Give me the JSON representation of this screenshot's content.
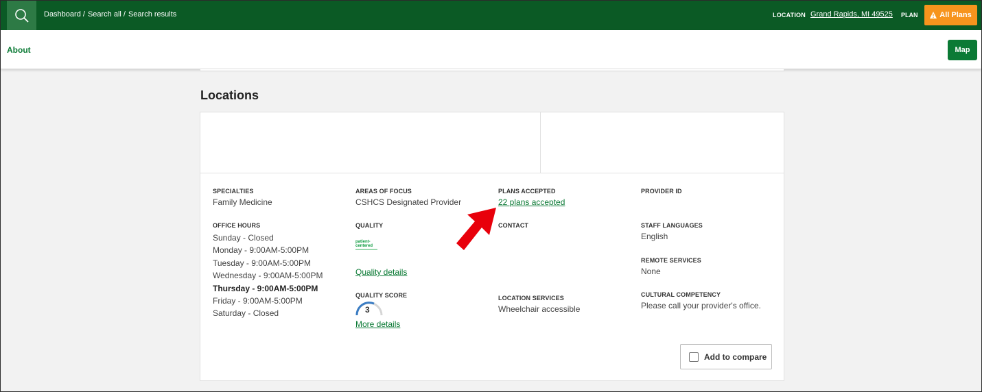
{
  "header": {
    "breadcrumbs": [
      "Dashboard /",
      "Search all /",
      "Search results"
    ],
    "location_label": "LOCATION",
    "location_value": "Grand Rapids, MI 49525",
    "plan_label": "PLAN",
    "plan_button": "All Plans",
    "colors": {
      "header_bg": "#0b5a25",
      "plan_button_bg": "#f7941d"
    }
  },
  "subnav": {
    "about": "About",
    "map_button": "Map"
  },
  "section_title": "Locations",
  "card": {
    "specialties_label": "SPECIALTIES",
    "specialties_value": "Family Medicine",
    "office_hours_label": "OFFICE HOURS",
    "office_hours": [
      "Sunday - Closed",
      "Monday - 9:00AM-5:00PM",
      "Tuesday - 9:00AM-5:00PM",
      "Wednesday - 9:00AM-5:00PM",
      "Thursday - 9:00AM-5:00PM",
      "Friday - 9:00AM-5:00PM",
      "Saturday - Closed"
    ],
    "areas_label": "AREAS OF FOCUS",
    "areas_value": "CSHCS Designated Provider",
    "quality_label": "QUALITY",
    "quality_logo_text": [
      "patient-",
      "centered"
    ],
    "quality_details_link": "Quality details",
    "quality_score_label": "QUALITY SCORE",
    "quality_score_value": "3",
    "more_details_link": "More details",
    "plans_label": "PLANS ACCEPTED",
    "plans_link": "22 plans accepted",
    "contact_label": "CONTACT",
    "location_services_label": "LOCATION SERVICES",
    "location_services_value": "Wheelchair accessible",
    "provider_id_label": "PROVIDER ID",
    "staff_languages_label": "STAFF LANGUAGES",
    "staff_languages_value": "English",
    "remote_services_label": "REMOTE SERVICES",
    "remote_services_value": "None",
    "cultural_label": "CULTURAL COMPETENCY",
    "cultural_value": "Please call your provider's office.",
    "compare_button": "Add to compare"
  },
  "icons": [
    "search-icon",
    "warning-icon",
    "checkbox-icon",
    "annotation-arrow-icon"
  ]
}
